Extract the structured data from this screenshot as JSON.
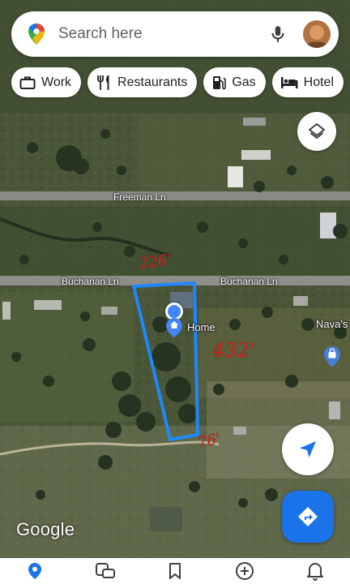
{
  "search": {
    "placeholder": "Search here"
  },
  "chips": [
    {
      "label": "Work",
      "icon": "briefcase-icon"
    },
    {
      "label": "Restaurants",
      "icon": "fork-knife-icon"
    },
    {
      "label": "Gas",
      "icon": "gas-pump-icon"
    },
    {
      "label": "Hotel",
      "icon": "bed-icon"
    }
  ],
  "map": {
    "roads": {
      "upper": "Freeman Ln",
      "lower_left": "Buchanan Ln",
      "lower_right": "Buchanan Ln"
    },
    "pins": {
      "home": "Home",
      "store": "Nava's"
    },
    "annotations": {
      "top_width": "226'",
      "side_length": "432'",
      "bottom_width": "76'"
    }
  },
  "brand": "Google",
  "bottom_nav": [
    {
      "name": "explore",
      "icon": "location-pin-icon",
      "active": true
    },
    {
      "name": "commute",
      "icon": "commute-icon",
      "active": false
    },
    {
      "name": "saved",
      "icon": "bookmark-icon",
      "active": false
    },
    {
      "name": "contribute",
      "icon": "add-circle-icon",
      "active": false
    },
    {
      "name": "updates",
      "icon": "bell-icon",
      "active": false
    }
  ],
  "colors": {
    "accent": "#1a73e8",
    "property_outline": "#1e88ff",
    "handwriting": "#d2281e"
  }
}
